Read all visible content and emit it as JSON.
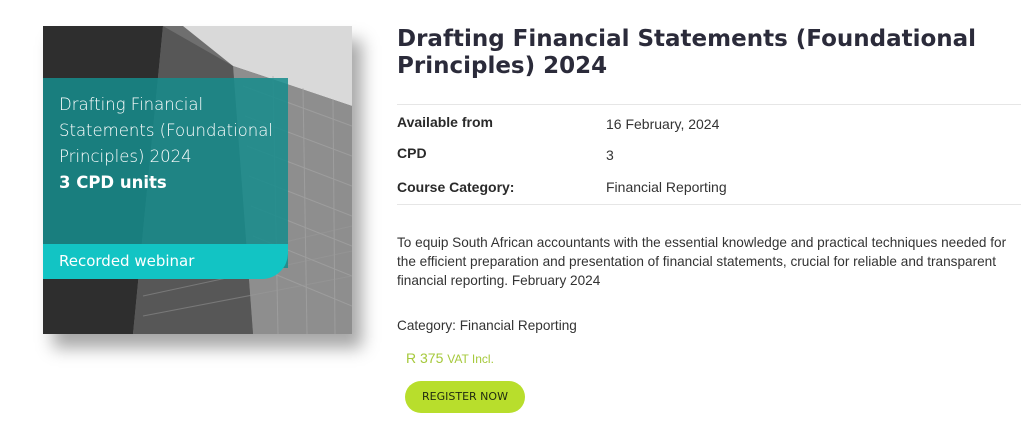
{
  "product_image": {
    "panel_title_lines": [
      "Drafting Financial",
      "Statements (Foundational",
      "Principles) 2024"
    ],
    "panel_units": "3 CPD units",
    "panel_footer": "Recorded webinar",
    "accent_color": "#168c8c",
    "footer_color": "#12c4c4"
  },
  "course": {
    "title": "Drafting Financial Statements (Foundational Principles) 2024",
    "details": [
      {
        "label": "Available from",
        "value": "16 February, 2024"
      },
      {
        "label": "CPD",
        "value": "3"
      },
      {
        "label": "Course Category:",
        "value": "Financial Reporting"
      }
    ],
    "description": "To equip South African accountants with the essential knowledge and practical techniques needed for the efficient preparation and presentation of financial statements, crucial for reliable and transparent financial reporting. February 2024",
    "category_line": "Category: Financial Reporting",
    "price": "R 375",
    "price_suffix": "VAT Incl.",
    "price_color": "#a6c93c",
    "register_label": "REGISTER NOW",
    "register_color": "#b8de2c"
  }
}
